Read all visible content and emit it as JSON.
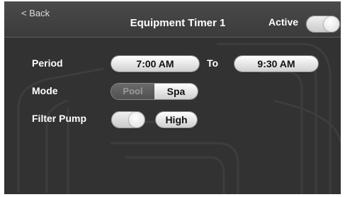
{
  "header": {
    "back_label": "< Back",
    "title": "Equipment Timer 1",
    "active_label": "Active",
    "active_on": true
  },
  "period": {
    "label": "Period",
    "start": "7:00 AM",
    "to_label": "To",
    "end": "9:30 AM"
  },
  "mode": {
    "label": "Mode",
    "options": [
      "Pool",
      "Spa"
    ],
    "selected": "Spa"
  },
  "filter_pump": {
    "label": "Filter Pump",
    "on": true,
    "speed": "High"
  },
  "colors": {
    "screen_bg": "#323232",
    "header_bg": "#444444",
    "pill_bg": "#e6e6e6",
    "text": "#ffffff"
  }
}
